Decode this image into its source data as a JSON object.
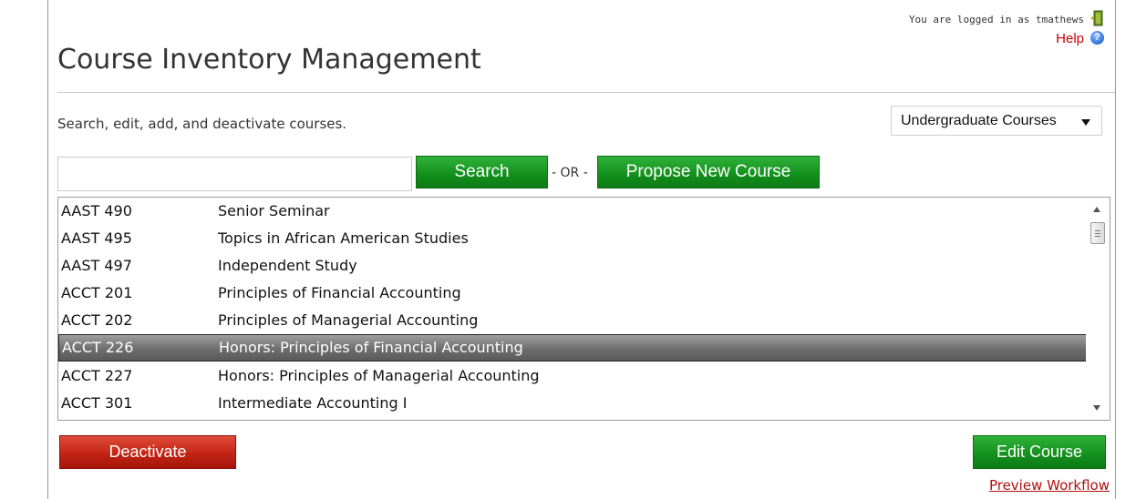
{
  "header": {
    "login_text": "You are logged in as tmathews",
    "help_label": "Help",
    "title": "Course Inventory Management"
  },
  "intro": {
    "subtitle": "Search, edit, add, and deactivate courses.",
    "level_selected": "Undergraduate Courses"
  },
  "search": {
    "input_value": "",
    "search_label": "Search",
    "or_text": "- OR -",
    "propose_label": "Propose New Course"
  },
  "courses": [
    {
      "code": "AAST 490",
      "name": "Senior Seminar",
      "selected": false
    },
    {
      "code": "AAST 495",
      "name": "Topics in African American Studies",
      "selected": false
    },
    {
      "code": "AAST 497",
      "name": "Independent Study",
      "selected": false
    },
    {
      "code": "ACCT 201",
      "name": "Principles of Financial Accounting",
      "selected": false
    },
    {
      "code": "ACCT 202",
      "name": "Principles of Managerial Accounting",
      "selected": false
    },
    {
      "code": "ACCT 226",
      "name": "Honors: Principles of Financial Accounting",
      "selected": true
    },
    {
      "code": "ACCT 227",
      "name": "Honors: Principles of Managerial Accounting",
      "selected": false
    },
    {
      "code": "ACCT 301",
      "name": "Intermediate Accounting I",
      "selected": false
    }
  ],
  "actions": {
    "deactivate_label": "Deactivate",
    "edit_label": "Edit Course",
    "preview_label": "Preview Workflow"
  },
  "icons": {
    "logout": "logout-door-icon",
    "help": "help-question-icon",
    "dropdown": "chevron-down-icon"
  },
  "colors": {
    "primary_button": "#14921e",
    "danger_button": "#c22414",
    "link": "#c00000",
    "selected_row": "#6e6e6e"
  }
}
